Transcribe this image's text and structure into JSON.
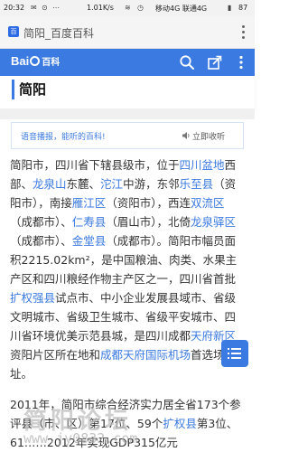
{
  "status_bar": {
    "time": "20:32",
    "network_speed": "1.01K/s",
    "network": "移动4G 联通4G",
    "battery": "87"
  },
  "browser": {
    "tab_title": "简阳_百度百科",
    "favicon_text": "百"
  },
  "app_header": {
    "logo_left": "Bai",
    "logo_right": "百科"
  },
  "article": {
    "heading": "简阳",
    "audio_prompt": "语音播报，能听的百科!",
    "audio_action": "立即收听",
    "paragraphs": [
      [
        {
          "t": "简阳市，四川省下辖县级市，位于"
        },
        {
          "t": "四川盆地",
          "link": true
        },
        {
          "t": "西部、"
        },
        {
          "t": "龙泉山",
          "link": true
        },
        {
          "t": "东麓、"
        },
        {
          "t": "沱江",
          "link": true
        },
        {
          "t": "中游，东邻"
        },
        {
          "t": "乐至县",
          "link": true
        },
        {
          "t": "（资阳市），南接"
        },
        {
          "t": "雁江区",
          "link": true
        },
        {
          "t": "（资阳市），西连"
        },
        {
          "t": "双流区",
          "link": true
        },
        {
          "t": "（成都市）、"
        },
        {
          "t": "仁寿县",
          "link": true
        },
        {
          "t": "（眉山市），北倚"
        },
        {
          "t": "龙泉驿区",
          "link": true
        },
        {
          "t": "（成都市）、"
        },
        {
          "t": "金堂县",
          "link": true
        },
        {
          "t": "（成都市）。简阳市幅员面积2215.02km²，是中国粮油、肉类、水果主产区和四川粮经作物主产区之一，四川省首批"
        },
        {
          "t": "扩权强县",
          "link": true
        },
        {
          "t": "试点市、中小企业发展县域市、省级文明城市、省级卫生城市、省级平安城市、四川省环境优美示范县城，是四川成都"
        },
        {
          "t": "天府新区",
          "link": true
        },
        {
          "t": "资阳片区所在地和"
        },
        {
          "t": "成都天府国际机场",
          "link": true
        },
        {
          "t": "首选场址。"
        }
      ],
      [
        {
          "t": "2011年，简阳市综合经济实力居全省173个参评县（市、区）第17位、59个"
        },
        {
          "t": "扩权县",
          "link": true
        },
        {
          "t": "第3位、61……2012年实现GDP315亿元"
        }
      ]
    ]
  },
  "watermark": {
    "line1": "简阳论坛",
    "line2": "www.jy0832.com"
  },
  "colors": {
    "accent": "#3b7ae0",
    "link": "#3b7ae0",
    "text": "#333333"
  }
}
